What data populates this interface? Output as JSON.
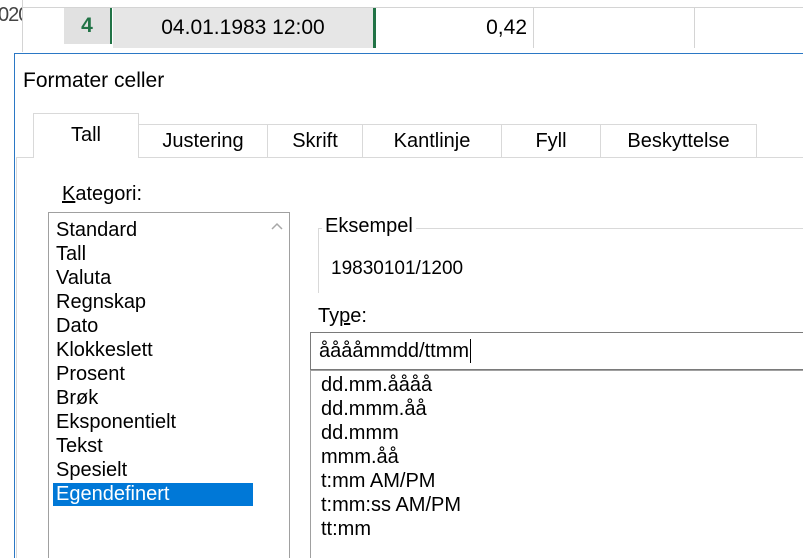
{
  "sheet": {
    "row_header_fragment": "020",
    "row_number": "4",
    "date_cell": "04.01.1983 12:00",
    "value_cell": "0,42"
  },
  "dialog": {
    "title": "Formater celler",
    "tabs": [
      {
        "label": "Tall",
        "active": true
      },
      {
        "label": "Justering"
      },
      {
        "label": "Skrift"
      },
      {
        "label": "Kantlinje"
      },
      {
        "label": "Fyll"
      },
      {
        "label": "Beskyttelse"
      }
    ],
    "category_label_prefix": "K",
    "category_label_rest": "ategori:",
    "categories": [
      "Standard",
      "Tall",
      "Valuta",
      "Regnskap",
      "Dato",
      "Klokkeslett",
      "Prosent",
      "Brøk",
      "Eksponentielt",
      "Tekst",
      "Spesielt",
      "Egendefinert"
    ],
    "selected_category": "Egendefinert",
    "sample_legend": "Eksempel",
    "sample_value": "19830101/1200",
    "type_label_prefix": "Ty",
    "type_label_underline": "p",
    "type_label_rest": "e:",
    "type_value": "ååååmmdd/ttmm",
    "type_options": [
      "dd.mm.åååå",
      "dd.mmm.åå",
      "dd.mmm",
      "mmm.åå",
      "t:mm AM/PM",
      "t:mm:ss AM/PM",
      "tt:mm"
    ]
  },
  "colors": {
    "selection": "#0078d7",
    "excel_green": "#217346",
    "dialog_border": "#2b78c5"
  }
}
